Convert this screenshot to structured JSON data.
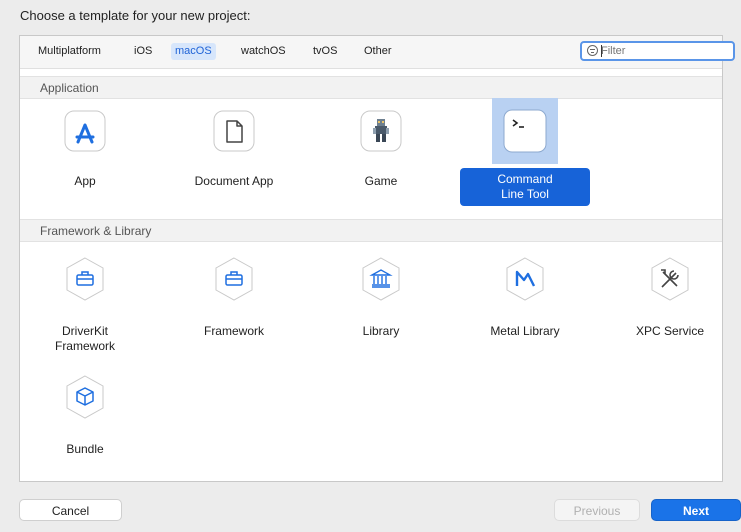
{
  "dialog": {
    "title": "Choose a template for your new project:",
    "filter_placeholder": "Filter"
  },
  "platform_tabs": [
    {
      "label": "Multiplatform",
      "active": false
    },
    {
      "label": "iOS",
      "active": false
    },
    {
      "label": "macOS",
      "active": true
    },
    {
      "label": "watchOS",
      "active": false
    },
    {
      "label": "tvOS",
      "active": false
    },
    {
      "label": "Other",
      "active": false
    }
  ],
  "sections": {
    "application": {
      "title": "Application",
      "items": [
        {
          "label": "App",
          "icon": "app-store-icon"
        },
        {
          "label": "Document App",
          "icon": "document-icon"
        },
        {
          "label": "Game",
          "icon": "game-sprite-icon"
        },
        {
          "label_lines": [
            "Command",
            "Line Tool"
          ],
          "icon": "terminal-icon",
          "selected": true
        }
      ]
    },
    "framework_library": {
      "title": "Framework & Library",
      "items": [
        {
          "label_lines": [
            "DriverKit",
            "Framework"
          ],
          "icon": "toolbox-icon"
        },
        {
          "label": "Framework",
          "icon": "toolbox-icon"
        },
        {
          "label": "Library",
          "icon": "building-columns-icon"
        },
        {
          "label": "Metal Library",
          "icon": "metal-icon"
        },
        {
          "label": "XPC Service",
          "icon": "wrench-screwdriver-icon"
        },
        {
          "label": "Bundle",
          "icon": "cube-icon"
        }
      ]
    }
  },
  "footer": {
    "cancel": "Cancel",
    "previous": "Previous",
    "next": "Next"
  },
  "colors": {
    "accent": "#1763d8",
    "selection_bg": "#b9d1f2",
    "active_tab_text": "#1f63d6"
  }
}
